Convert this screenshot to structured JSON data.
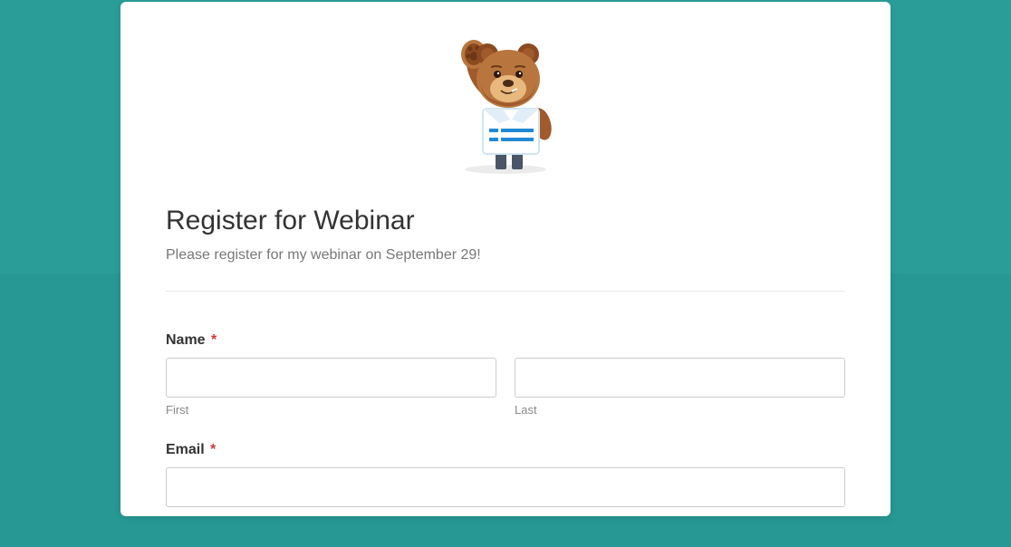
{
  "form": {
    "title": "Register for Webinar",
    "description": "Please register for my webinar on September 29!",
    "fields": {
      "name": {
        "label": "Name",
        "required_marker": "*",
        "first_sublabel": "First",
        "last_sublabel": "Last",
        "first_value": "",
        "last_value": ""
      },
      "email": {
        "label": "Email",
        "required_marker": "*",
        "value": ""
      }
    }
  },
  "mascot": {
    "name": "bear-mascot-icon"
  }
}
